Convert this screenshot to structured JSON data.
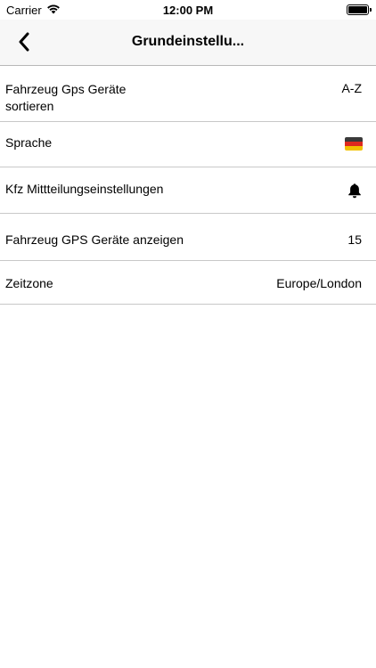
{
  "status_bar": {
    "carrier": "Carrier",
    "time": "12:00 PM"
  },
  "nav": {
    "title": "Grundeinstellu..."
  },
  "settings": {
    "sort_label": "Fahrzeug Gps Geräte sortieren",
    "sort_value": "A-Z",
    "language_label": "Sprache",
    "language_flag": "german-flag-icon",
    "notification_label": "Kfz Mittteilungseinstellungen",
    "notification_icon": "bell-icon",
    "count_label": "Fahrzeug GPS Geräte anzeigen",
    "count_value": "15",
    "timezone_label": "Zeitzone",
    "timezone_value": "Europe/London"
  },
  "colors": {
    "nav_background": "#f7f7f7",
    "separator": "#c8c8c8",
    "flag_black": "#3a3a3a",
    "flag_red": "#dd2a1f",
    "flag_gold": "#f2c200"
  }
}
